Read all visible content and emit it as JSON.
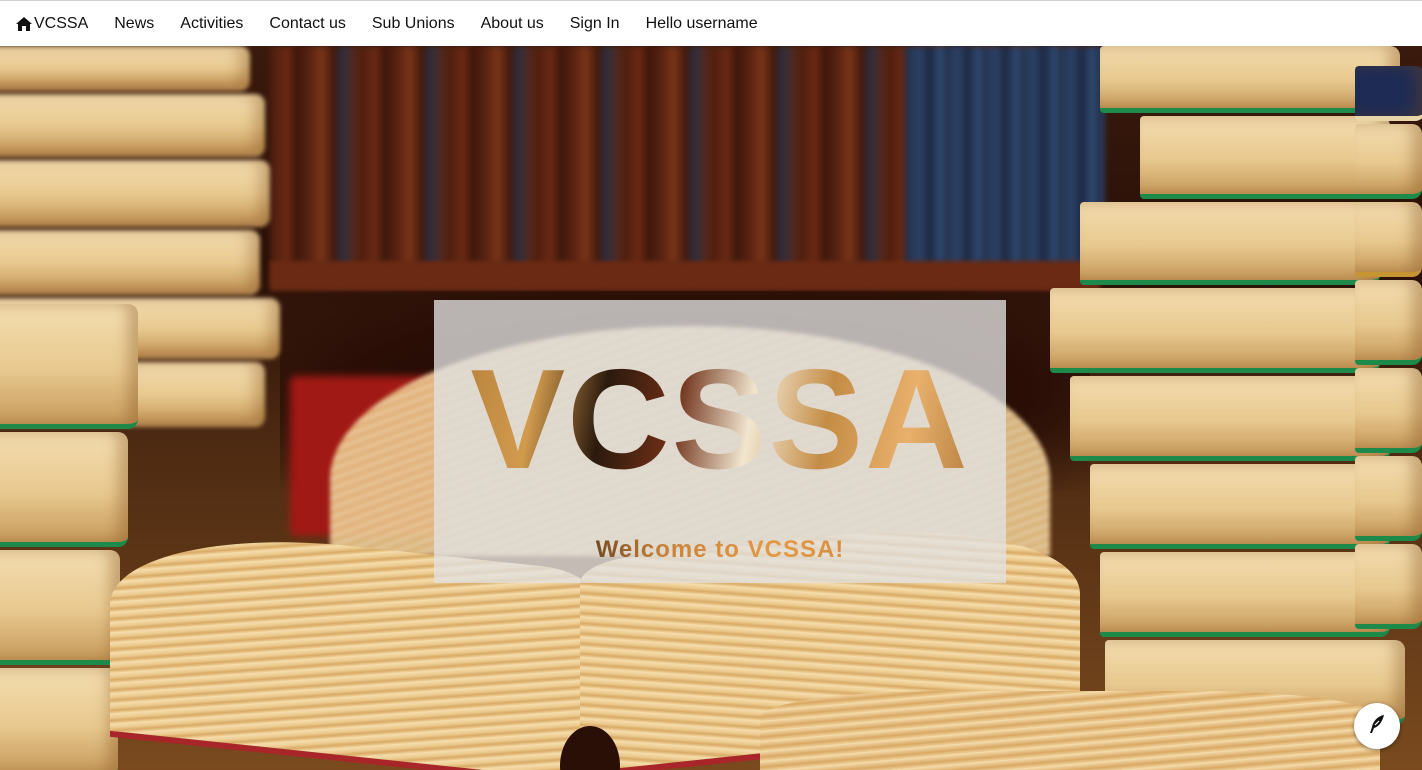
{
  "navbar": {
    "brand": {
      "icon": "home-icon",
      "label": "VCSSA"
    },
    "items": [
      {
        "label": "News"
      },
      {
        "label": "Activities"
      },
      {
        "label": "Contact us"
      },
      {
        "label": "Sub Unions"
      },
      {
        "label": "About us"
      },
      {
        "label": "Sign In"
      },
      {
        "label": "Hello username"
      }
    ]
  },
  "hero": {
    "background": "library-books-photo",
    "title": "VCSSA",
    "subtitle": "Welcome to VCSSA!"
  },
  "floating_button": {
    "icon": "feather-icon"
  },
  "colors": {
    "navbar_bg": "#ffffff",
    "panel_bg": "#e1e1e1",
    "book_edge_green": "#1d8a4a"
  }
}
